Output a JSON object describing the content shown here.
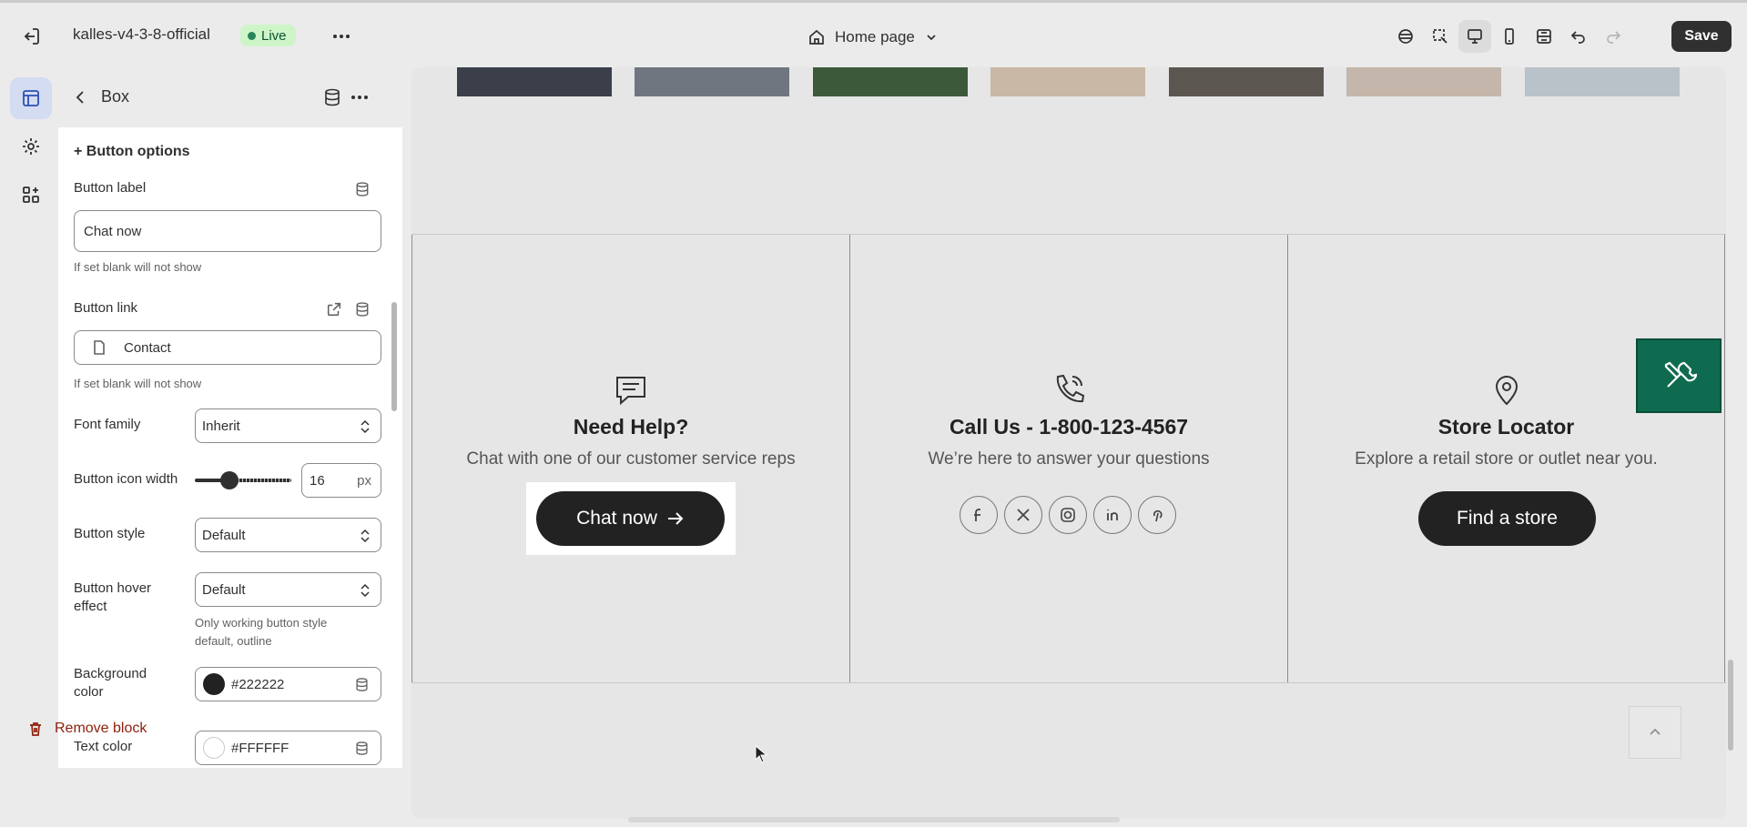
{
  "topbar": {
    "store_name": "kalles-v4-3-8-official",
    "status": "Live",
    "page": "Home page",
    "save_label": "Save"
  },
  "sidebar_header": {
    "title": "Box"
  },
  "panel": {
    "section_title": "+ Button options",
    "button_label": {
      "label": "Button label",
      "value": "Chat now",
      "help": "If set blank will not show"
    },
    "button_link": {
      "label": "Button link",
      "value": "Contact",
      "help": "If set blank will not show"
    },
    "font_family": {
      "label": "Font family",
      "value": "Inherit"
    },
    "icon_width": {
      "label": "Button icon width",
      "value": "16",
      "unit": "px",
      "level": 0.4
    },
    "button_style": {
      "label": "Button style",
      "value": "Default"
    },
    "hover_effect": {
      "label_line1": "Button hover",
      "label_line2": "effect",
      "value": "Default",
      "help_line1": "Only working button style",
      "help_line2": "default, outline"
    },
    "background_color": {
      "label_line1": "Background",
      "label_line2": "color",
      "value": "#222222",
      "swatch": "#222222"
    },
    "text_color": {
      "label": "Text color",
      "value": "#FFFFFF",
      "swatch": "#FFFFFF"
    },
    "remove_label": "Remove block"
  },
  "preview": {
    "boxes": [
      {
        "title": "Need Help?",
        "subtitle": "Chat with one of our customer service reps",
        "button": "Chat now"
      },
      {
        "title": "Call Us - 1-800-123-4567",
        "subtitle": "We’re here to answer your questions"
      },
      {
        "title": "Store Locator",
        "subtitle": "Explore a retail store or outlet near you.",
        "button": "Find a store"
      }
    ],
    "socials": [
      "facebook-icon",
      "x-icon",
      "instagram-icon",
      "linkedin-icon",
      "pinterest-icon"
    ]
  },
  "colors": {
    "accent": "#0f6b4f",
    "button": "#222222",
    "save": "#303030",
    "live_bg": "#cdf5c8"
  }
}
